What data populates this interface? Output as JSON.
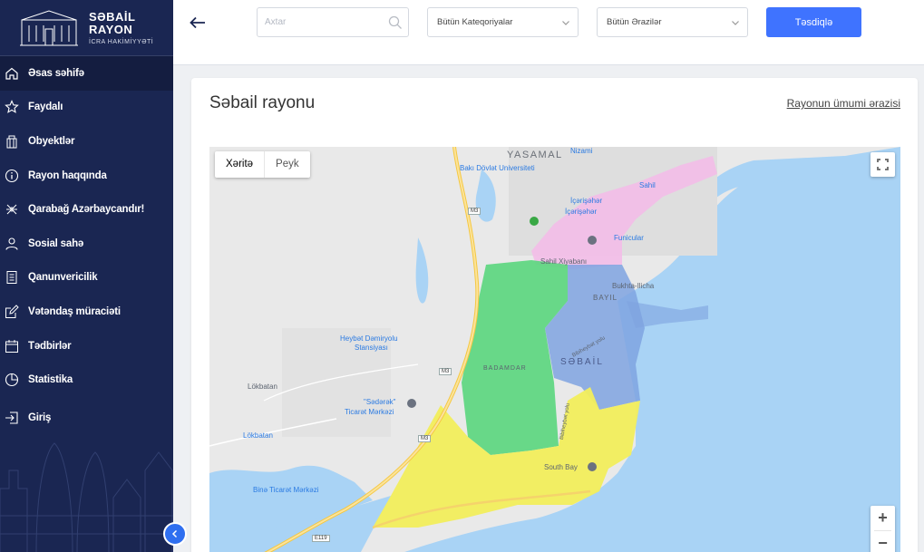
{
  "logo": {
    "line1": "SƏBAİL",
    "line2": "RAYON",
    "line3": "İCRA HAKİMİYYƏTİ"
  },
  "sidebar": {
    "items": [
      {
        "label": "Əsas səhifə",
        "icon": "home-icon",
        "active": true
      },
      {
        "label": "Faydalı",
        "icon": "star-icon"
      },
      {
        "label": "Obyektlər",
        "icon": "building-icon"
      },
      {
        "label": "Rayon haqqında",
        "icon": "info-icon"
      },
      {
        "label": "Qarabağ Azərbaycandır!",
        "icon": "karabakh-icon"
      },
      {
        "label": "Sosial sahə",
        "icon": "person-icon"
      },
      {
        "label": "Qanunvericilik",
        "icon": "document-icon"
      },
      {
        "label": "Vətəndaş müraciəti",
        "icon": "edit-icon"
      },
      {
        "label": "Tədbirlər",
        "icon": "calendar-icon"
      },
      {
        "label": "Statistika",
        "icon": "pie-chart-icon"
      },
      {
        "label": "Giriş",
        "icon": "login-icon"
      }
    ]
  },
  "topbar": {
    "search_placeholder": "Axtar",
    "category_select": "Bütün Kateqoriyalar",
    "area_select": "Bütün Ərazilər",
    "confirm_label": "Təsdiqlə"
  },
  "card": {
    "title": "Səbail rayonu",
    "link": "Rayonun ümumi ərazisi"
  },
  "map": {
    "type_buttons": [
      "Xəritə",
      "Peyk"
    ],
    "labels": {
      "yasamal": "YASAMAL",
      "nizami": "Nizami",
      "bdu": "Bakı Dövlət Universiteti",
      "icherisheher1": "İçərişəhər",
      "icherisheher2": "İçərişəhər",
      "sahil": "Sahil",
      "funicular": "Funicular",
      "sahil_park": "Sahil Xiyabanı",
      "bukhta": "Bukhta-Ilicha",
      "bayil": "BAYIL",
      "sebail": "SƏBAİL",
      "badamdar": "BADAMDAR",
      "heybat1": "Heybət Dəmiryolu",
      "heybat2": "Stansiyası",
      "lokbatan": "Lökbatan",
      "lokbatan_station": "Lökbatan",
      "sadarak1": "\"Sədərək\"",
      "sadarak2": "Ticarət Mərkəzi",
      "south_bay": "South Bay",
      "bina": "Binə Ticarət Mərkəzi",
      "m3a": "M3",
      "m3b": "M3",
      "m3c": "M3",
      "e119": "E119",
      "bibiheybat": "Bibiheybət yolu",
      "bibiheybat2": "Bibiheybət yolu"
    }
  },
  "colors": {
    "sidebar_bg": "#1a2652",
    "accent": "#3f73ff",
    "zone_green": "#5ad67d",
    "zone_blue": "#7fa3e0",
    "zone_yellow": "#f2ee5c",
    "zone_pink": "#f3bde8",
    "water": "#a9d3f5"
  }
}
